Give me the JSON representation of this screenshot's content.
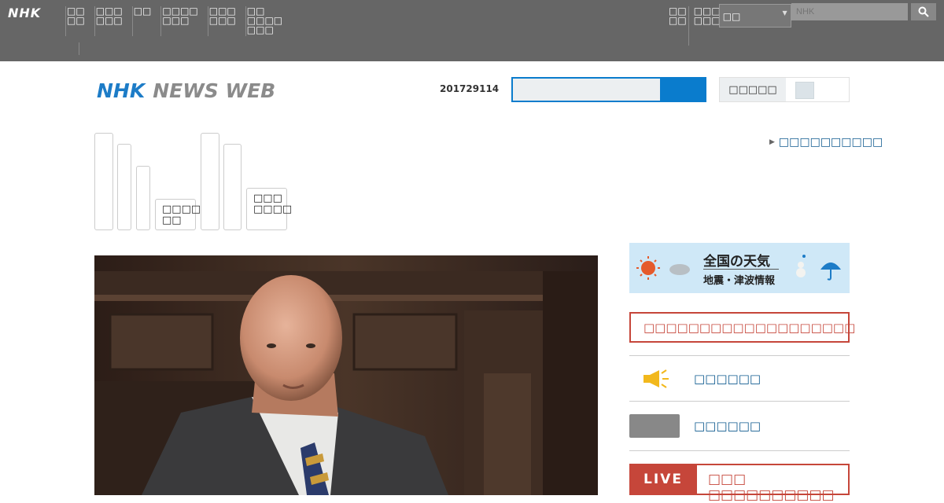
{
  "topbar": {
    "logo": "NHK",
    "nav": [
      "□□\n□□",
      "□□□\n□□□",
      "□□",
      "□□□□\n□□□",
      "□□□\n□□□",
      "□□\n□□□□\n□□□"
    ],
    "right_nav_1": "□□\n□□",
    "right_nav_2": "□□□\n□□□",
    "region_value": "□□",
    "search_placeholder": "NHK"
  },
  "header": {
    "logo_nhk": "NHK",
    "logo_news": "NEWS WEB",
    "date": "201729114",
    "toggle_label": "□□□□□"
  },
  "categories": [
    {
      "label": ""
    },
    {
      "label": ""
    },
    {
      "label": ""
    },
    {
      "label": "□□□□\n□□"
    },
    {
      "label": ""
    },
    {
      "label": ""
    },
    {
      "label": "□□□\n□□□□"
    }
  ],
  "category_link": "□□□□□□□□□□",
  "sidebar": {
    "weather_title": "全国の天気",
    "weather_sub": "地震・津波情報",
    "red_notice": "□□□□□□□□□□□□□□□□□□□",
    "link_1": "□□□□□□",
    "link_2": "□□□□□□",
    "live_label": "LIVE",
    "live_text": "□□□ □□□□□□□□□□"
  },
  "colors": {
    "topbar": "#666666",
    "brand_blue": "#1d7cc7",
    "search_blue": "#0a7ccd",
    "alert_red": "#c6463a",
    "link_blue": "#0e5a8f"
  }
}
